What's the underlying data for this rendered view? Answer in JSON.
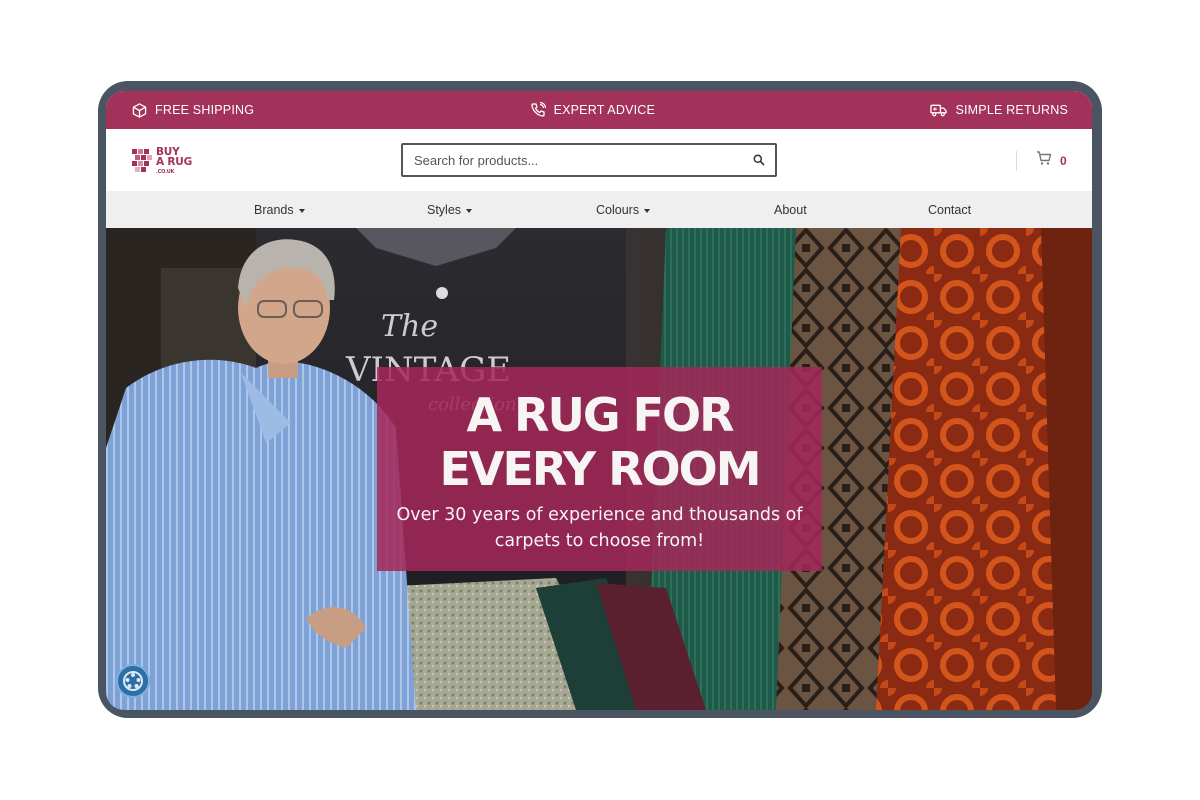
{
  "promo_bar": {
    "items": [
      {
        "label": "FREE SHIPPING",
        "icon": "box-icon"
      },
      {
        "label": "EXPERT ADVICE",
        "icon": "phone-icon"
      },
      {
        "label": "SIMPLE RETURNS",
        "icon": "truck-icon"
      }
    ]
  },
  "header": {
    "logo": {
      "line1": "BUY",
      "line2": "A RUG",
      "suffix": ".CO.UK"
    },
    "search": {
      "placeholder": "Search for products..."
    },
    "cart": {
      "count": "0"
    }
  },
  "nav": {
    "items": [
      {
        "label": "Brands"
      },
      {
        "label": "Styles"
      },
      {
        "label": "Colours"
      },
      {
        "label": "About"
      },
      {
        "label": "Contact"
      }
    ]
  },
  "hero": {
    "title_line1": "A RUG FOR",
    "title_line2": "EVERY ROOM",
    "subtitle": "Over 30 years of experience and thousands of carpets to choose from!",
    "backdrop_text_1": "The",
    "backdrop_text_2": "VINTAGE",
    "backdrop_text_3": "collection"
  },
  "colors": {
    "brand": "#a3325b",
    "nav_bg": "#efefef",
    "hero_box": "#a32858"
  }
}
